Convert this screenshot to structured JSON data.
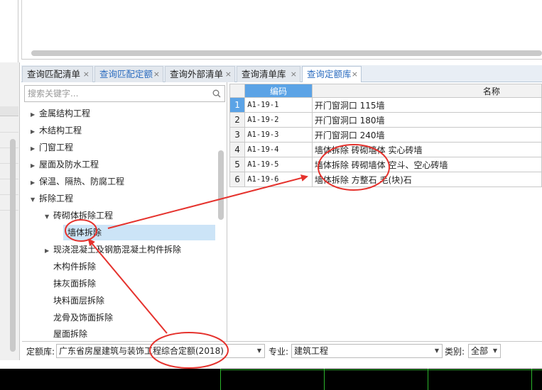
{
  "tabs": [
    {
      "label": "查询匹配清单",
      "close": "×"
    },
    {
      "label": "查询匹配定额",
      "close": "×"
    },
    {
      "label": "查询外部清单",
      "close": "×"
    },
    {
      "label": "查询清单库",
      "close": "×"
    },
    {
      "label": "查询定额库",
      "close": "×"
    }
  ],
  "search": {
    "placeholder": "搜索关键字..."
  },
  "tree": [
    {
      "label": "金属结构工程",
      "expanded": false
    },
    {
      "label": "木结构工程",
      "expanded": false
    },
    {
      "label": "门窗工程",
      "expanded": false
    },
    {
      "label": "屋面及防水工程",
      "expanded": false
    },
    {
      "label": "保温、隔热、防腐工程",
      "expanded": false
    },
    {
      "label": "拆除工程",
      "expanded": true
    },
    {
      "label": "砖砌体拆除工程",
      "expanded": true
    },
    {
      "label": "墙体拆除",
      "selected": true
    },
    {
      "label": "现浇混凝土及钢筋混凝土构件拆除",
      "expanded": false
    },
    {
      "label": "木构件拆除"
    },
    {
      "label": "抹灰面拆除"
    },
    {
      "label": "块料面层拆除"
    },
    {
      "label": "龙骨及饰面拆除"
    },
    {
      "label": "屋面拆除"
    }
  ],
  "grid": {
    "headers": {
      "code": "编码",
      "name": "名称"
    },
    "rows": [
      {
        "num": "1",
        "code": "A1-19-1",
        "name": "开门窗洞口 115墙"
      },
      {
        "num": "2",
        "code": "A1-19-2",
        "name": "开门窗洞口 180墙"
      },
      {
        "num": "3",
        "code": "A1-19-3",
        "name": "开门窗洞口 240墙"
      },
      {
        "num": "4",
        "code": "A1-19-4",
        "name": "墙体拆除 砖砌墙体 实心砖墙"
      },
      {
        "num": "5",
        "code": "A1-19-5",
        "name": "墙体拆除 砖砌墙体 空斗、空心砖墙"
      },
      {
        "num": "6",
        "code": "A1-19-6",
        "name": "墙体拆除 方整石 毛(块)石"
      }
    ]
  },
  "bottom": {
    "quota_label": "定额库:",
    "quota_value": "广东省房屋建筑与装饰工程综合定额(2018)",
    "major_label": "专业:",
    "major_value": "建筑工程",
    "type_label": "类别:",
    "type_value": "全部"
  },
  "colors": {
    "accent": "#5ba3e6",
    "tab_active_text": "#2a6bbf",
    "annotation": "#e5322d"
  },
  "icons": {
    "search": "search-icon",
    "dropdown": "caret-down-icon",
    "expand": "triangle-right-icon",
    "collapse": "triangle-down-icon"
  }
}
